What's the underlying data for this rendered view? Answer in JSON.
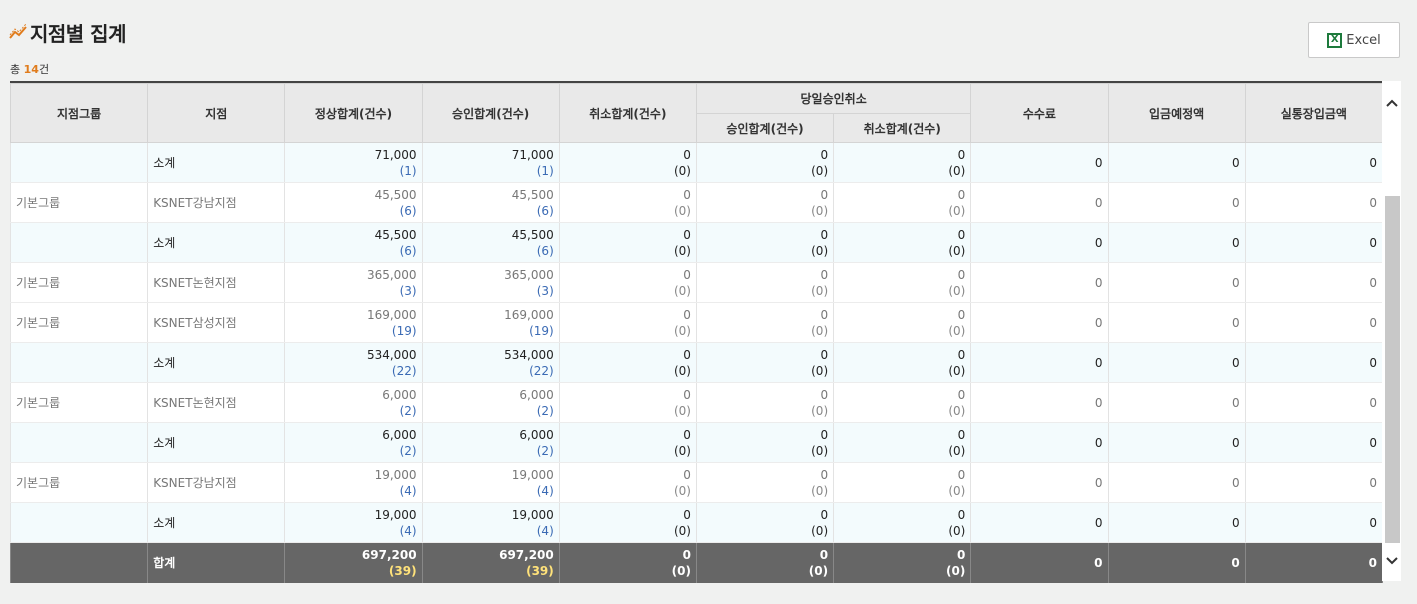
{
  "header": {
    "title": "지점별 집계",
    "total_prefix": "총 ",
    "total_count": "14",
    "total_suffix": "건"
  },
  "excel": {
    "label": "Excel",
    "icon_letter": "X"
  },
  "columns": {
    "group": "지점그룹",
    "branch": "지점",
    "normal_total": "정상합계(건수)",
    "approve_total": "승인합계(건수)",
    "cancel_total": "취소합계(건수)",
    "sameday": "당일승인취소",
    "sameday_approve": "승인합계(건수)",
    "sameday_cancel": "취소합계(건수)",
    "fee": "수수료",
    "deposit_expected": "입금예정액",
    "actual_deposit": "실통장입금액"
  },
  "rows": [
    {
      "type": "sub",
      "group": "",
      "branch": "소계",
      "normal": "71,000",
      "normal_cnt": "(1)",
      "approve": "71,000",
      "approve_cnt": "(1)",
      "cancel": "0",
      "cancel_cnt": "(0)",
      "sd_approve": "0",
      "sd_approve_cnt": "(0)",
      "sd_cancel": "0",
      "sd_cancel_cnt": "(0)",
      "fee": "0",
      "deposit": "0",
      "actual": "0"
    },
    {
      "type": "detail",
      "group": "기본그룹",
      "branch": "KSNET강남지점",
      "normal": "45,500",
      "normal_cnt": "(6)",
      "approve": "45,500",
      "approve_cnt": "(6)",
      "cancel": "0",
      "cancel_cnt": "(0)",
      "sd_approve": "0",
      "sd_approve_cnt": "(0)",
      "sd_cancel": "0",
      "sd_cancel_cnt": "(0)",
      "fee": "0",
      "deposit": "0",
      "actual": "0"
    },
    {
      "type": "sub",
      "group": "",
      "branch": "소계",
      "normal": "45,500",
      "normal_cnt": "(6)",
      "approve": "45,500",
      "approve_cnt": "(6)",
      "cancel": "0",
      "cancel_cnt": "(0)",
      "sd_approve": "0",
      "sd_approve_cnt": "(0)",
      "sd_cancel": "0",
      "sd_cancel_cnt": "(0)",
      "fee": "0",
      "deposit": "0",
      "actual": "0"
    },
    {
      "type": "detail",
      "group": "기본그룹",
      "branch": "KSNET논현지점",
      "normal": "365,000",
      "normal_cnt": "(3)",
      "approve": "365,000",
      "approve_cnt": "(3)",
      "cancel": "0",
      "cancel_cnt": "(0)",
      "sd_approve": "0",
      "sd_approve_cnt": "(0)",
      "sd_cancel": "0",
      "sd_cancel_cnt": "(0)",
      "fee": "0",
      "deposit": "0",
      "actual": "0"
    },
    {
      "type": "detail",
      "group": "기본그룹",
      "branch": "KSNET삼성지점",
      "normal": "169,000",
      "normal_cnt": "(19)",
      "approve": "169,000",
      "approve_cnt": "(19)",
      "cancel": "0",
      "cancel_cnt": "(0)",
      "sd_approve": "0",
      "sd_approve_cnt": "(0)",
      "sd_cancel": "0",
      "sd_cancel_cnt": "(0)",
      "fee": "0",
      "deposit": "0",
      "actual": "0"
    },
    {
      "type": "sub",
      "group": "",
      "branch": "소계",
      "normal": "534,000",
      "normal_cnt": "(22)",
      "approve": "534,000",
      "approve_cnt": "(22)",
      "cancel": "0",
      "cancel_cnt": "(0)",
      "sd_approve": "0",
      "sd_approve_cnt": "(0)",
      "sd_cancel": "0",
      "sd_cancel_cnt": "(0)",
      "fee": "0",
      "deposit": "0",
      "actual": "0"
    },
    {
      "type": "detail",
      "group": "기본그룹",
      "branch": "KSNET논현지점",
      "normal": "6,000",
      "normal_cnt": "(2)",
      "approve": "6,000",
      "approve_cnt": "(2)",
      "cancel": "0",
      "cancel_cnt": "(0)",
      "sd_approve": "0",
      "sd_approve_cnt": "(0)",
      "sd_cancel": "0",
      "sd_cancel_cnt": "(0)",
      "fee": "0",
      "deposit": "0",
      "actual": "0"
    },
    {
      "type": "sub",
      "group": "",
      "branch": "소계",
      "normal": "6,000",
      "normal_cnt": "(2)",
      "approve": "6,000",
      "approve_cnt": "(2)",
      "cancel": "0",
      "cancel_cnt": "(0)",
      "sd_approve": "0",
      "sd_approve_cnt": "(0)",
      "sd_cancel": "0",
      "sd_cancel_cnt": "(0)",
      "fee": "0",
      "deposit": "0",
      "actual": "0"
    },
    {
      "type": "detail",
      "group": "기본그룹",
      "branch": "KSNET강남지점",
      "normal": "19,000",
      "normal_cnt": "(4)",
      "approve": "19,000",
      "approve_cnt": "(4)",
      "cancel": "0",
      "cancel_cnt": "(0)",
      "sd_approve": "0",
      "sd_approve_cnt": "(0)",
      "sd_cancel": "0",
      "sd_cancel_cnt": "(0)",
      "fee": "0",
      "deposit": "0",
      "actual": "0"
    },
    {
      "type": "sub",
      "group": "",
      "branch": "소계",
      "normal": "19,000",
      "normal_cnt": "(4)",
      "approve": "19,000",
      "approve_cnt": "(4)",
      "cancel": "0",
      "cancel_cnt": "(0)",
      "sd_approve": "0",
      "sd_approve_cnt": "(0)",
      "sd_cancel": "0",
      "sd_cancel_cnt": "(0)",
      "fee": "0",
      "deposit": "0",
      "actual": "0"
    }
  ],
  "footer": {
    "group": "",
    "branch": "합계",
    "normal": "697,200",
    "normal_cnt": "(39)",
    "approve": "697,200",
    "approve_cnt": "(39)",
    "cancel": "0",
    "cancel_cnt": "(0)",
    "sd_approve": "0",
    "sd_approve_cnt": "(0)",
    "sd_cancel": "0",
    "sd_cancel_cnt": "(0)",
    "fee": "0",
    "deposit": "0",
    "actual": "0"
  },
  "scrollbar": {
    "up_icon": "chevron-up-icon",
    "down_icon": "chevron-down-icon"
  }
}
